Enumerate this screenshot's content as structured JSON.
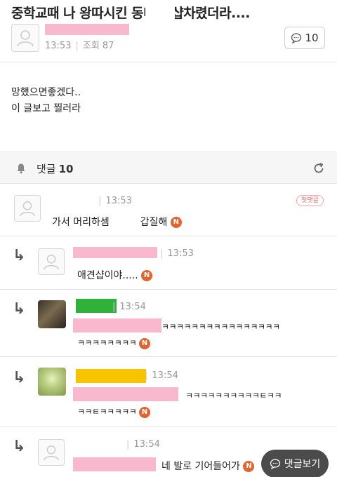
{
  "post": {
    "title": "중학교때 나 왕따시킨      동네에 샵차렸더라....",
    "time": "13:53",
    "views": "조회 87",
    "comment_count": "10",
    "body_line1": "망했으면좋겠다..",
    "body_line2": "이 글보고 찔러라"
  },
  "comments_header": {
    "label": "댓글",
    "count": "10"
  },
  "comments": [
    {
      "time": "13:53",
      "text_a": "가서 머리하셈",
      "text_b": "갑질해",
      "badge": "N",
      "tag": "첫댓글"
    },
    {
      "time": "13:53",
      "text": "애견샵이야.....",
      "badge": "N"
    },
    {
      "time": "13:54",
      "text1": "ㅋㅋㅋㅋㅋㅋㅋㅋㅋㅋㅋㅋㅋㅋㅋㅋ",
      "text2": "ㅋㅋㅋㅋㅋㅋㅋㅋ",
      "badge": "N"
    },
    {
      "time": "13:54",
      "text1": "ㅋㅋㅋㅋㅋㅋㅋㅋㅋㅋㅌㅋㅋ",
      "text2": "ㅋㅋㅌㅋㅋㅋㅋㅋ",
      "badge": "N"
    },
    {
      "time": "13:54",
      "text": "네 발로 기어들어가",
      "badge": "N"
    }
  ],
  "floating": {
    "label": "댓글보기"
  },
  "colors": {
    "accent_badge": "#e2632f",
    "redact_pink": "#f8b9cf",
    "redact_green": "#2fb23a",
    "redact_yellow": "#f8c300"
  }
}
